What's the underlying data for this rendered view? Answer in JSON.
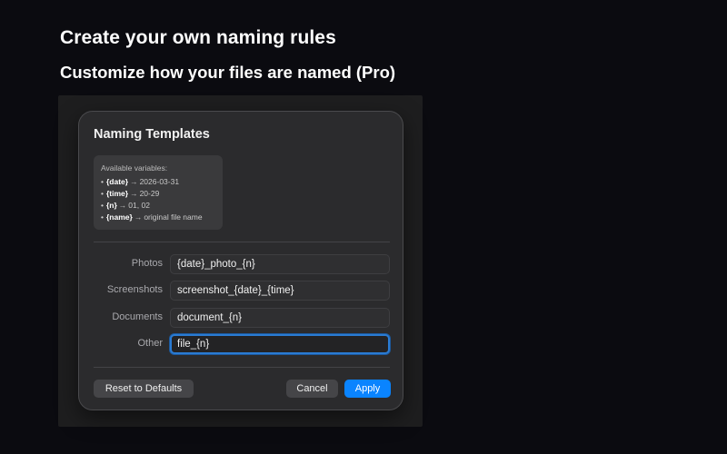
{
  "marketing": {
    "headline": "Create your own naming rules",
    "subheadline": "Customize how your files are named (Pro)"
  },
  "dialog": {
    "title": "Naming Templates",
    "variables": {
      "title": "Available variables:",
      "items": [
        {
          "token": "{date}",
          "example": "2026-03-31"
        },
        {
          "token": "{time}",
          "example": "20-29"
        },
        {
          "token": "{n}",
          "example": "01, 02"
        },
        {
          "token": "{name}",
          "example": "original file name"
        }
      ]
    },
    "rows": [
      {
        "label": "Photos",
        "value": "{date}_photo_{n}"
      },
      {
        "label": "Screenshots",
        "value": "screenshot_{date}_{time}"
      },
      {
        "label": "Documents",
        "value": "document_{n}"
      },
      {
        "label": "Other",
        "value": "file_{n}"
      }
    ],
    "buttons": {
      "reset": "Reset to Defaults",
      "cancel": "Cancel",
      "apply": "Apply"
    },
    "colors": {
      "accent": "#0a84ff",
      "focus_ring": "#2a7bd3",
      "dialog_bg": "#2b2b2d"
    }
  }
}
